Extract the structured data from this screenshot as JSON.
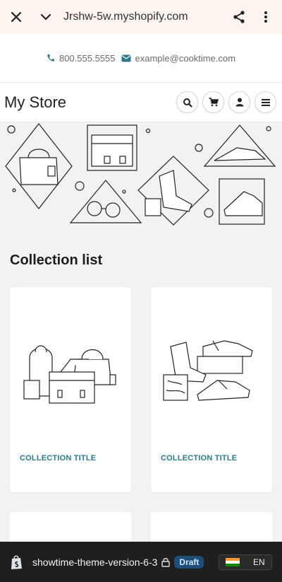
{
  "browser": {
    "url": "Jrshw-5w.myshopify.com",
    "icons": [
      "close-icon",
      "chevron-down-icon",
      "share-icon",
      "more-vert-icon"
    ]
  },
  "contact": {
    "phone": "800.555.5555",
    "email": "example@cooktime.com"
  },
  "header": {
    "title": "My Store",
    "icons": [
      "search-icon",
      "cart-icon",
      "account-icon",
      "menu-icon"
    ]
  },
  "collections": {
    "title": "Collection list",
    "cards": [
      {
        "label": "COLLECTION TITLE"
      },
      {
        "label": "COLLECTION TITLE"
      }
    ]
  },
  "shopify_bar": {
    "store_name": "showtime-theme-version-6-3",
    "status": "Draft",
    "locale": "EN",
    "colors": {
      "draft_bg": "#1f4e78",
      "bar_bg": "#1f1f1f"
    }
  },
  "colors": {
    "accent": "#2b7a8c"
  }
}
